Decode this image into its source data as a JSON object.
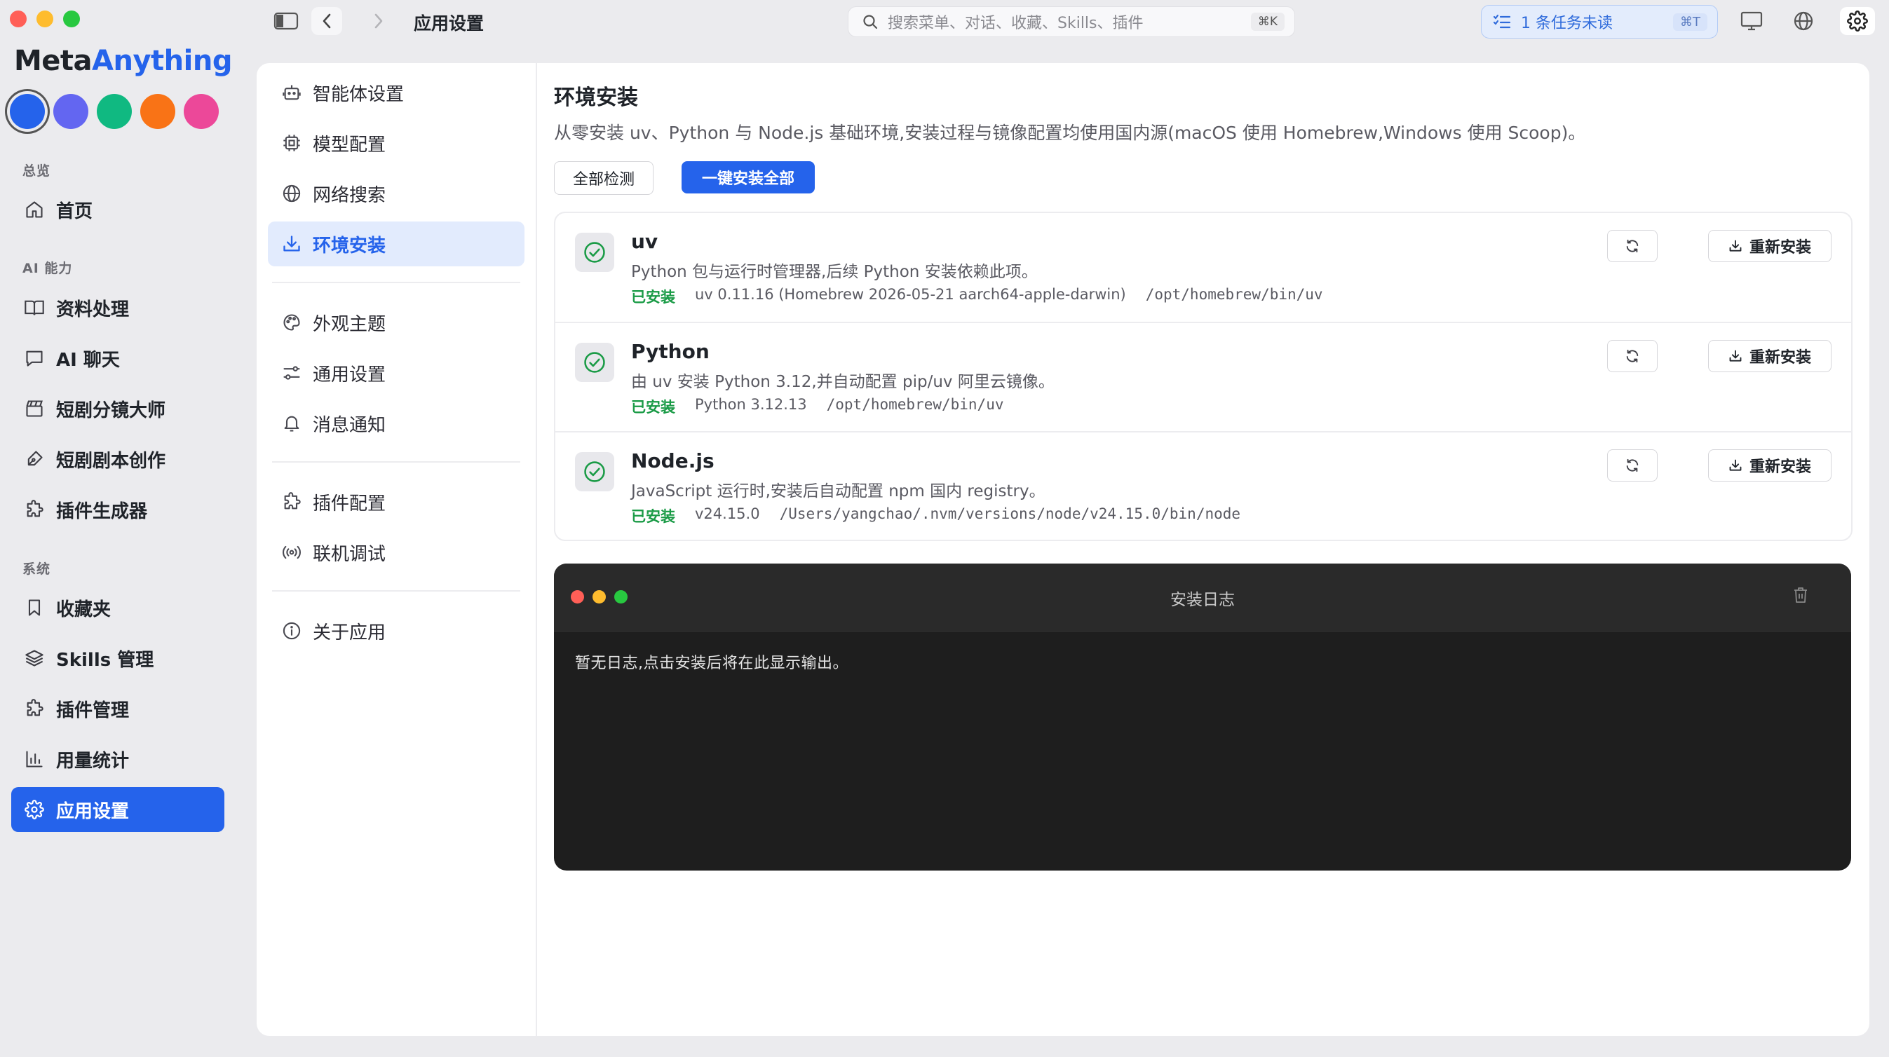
{
  "window": {
    "title": "应用设置"
  },
  "search": {
    "placeholder": "搜索菜单、对话、收藏、Skills、插件",
    "shortcut": "⌘K"
  },
  "tasks": {
    "label": "1 条任务未读",
    "shortcut": "⌘T"
  },
  "brand": {
    "part1": "Meta",
    "part2": "Anything"
  },
  "theme_colors": [
    "#2563eb",
    "#6366f1",
    "#10b981",
    "#f97316",
    "#ec4899"
  ],
  "sidebar": {
    "groups": [
      {
        "label": "总览",
        "items": [
          {
            "label": "首页",
            "icon": "home-icon"
          }
        ]
      },
      {
        "label": "AI 能力",
        "items": [
          {
            "label": "资料处理",
            "icon": "book-icon"
          },
          {
            "label": "AI 聊天",
            "icon": "chat-icon"
          },
          {
            "label": "短剧分镜大师",
            "icon": "clapper-icon"
          },
          {
            "label": "短剧剧本创作",
            "icon": "pen-icon"
          },
          {
            "label": "插件生成器",
            "icon": "puzzle-icon"
          }
        ]
      },
      {
        "label": "系统",
        "items": [
          {
            "label": "收藏夹",
            "icon": "bookmark-icon"
          },
          {
            "label": "Skills 管理",
            "icon": "layers-icon"
          },
          {
            "label": "插件管理",
            "icon": "puzzle-icon"
          },
          {
            "label": "用量统计",
            "icon": "bar-chart-icon"
          },
          {
            "label": "应用设置",
            "icon": "gear-icon",
            "active": true
          }
        ]
      }
    ]
  },
  "settings_nav": [
    {
      "label": "智能体设置",
      "icon": "bot-icon"
    },
    {
      "label": "模型配置",
      "icon": "chip-icon"
    },
    {
      "label": "网络搜索",
      "icon": "globe-icon"
    },
    {
      "label": "环境安装",
      "icon": "download-icon",
      "active": true
    },
    {
      "label": "外观主题",
      "icon": "palette-icon"
    },
    {
      "label": "通用设置",
      "icon": "sliders-icon"
    },
    {
      "label": "消息通知",
      "icon": "bell-icon"
    },
    {
      "label": "插件配置",
      "icon": "puzzle-icon"
    },
    {
      "label": "联机调试",
      "icon": "broadcast-icon"
    },
    {
      "label": "关于应用",
      "icon": "info-icon"
    }
  ],
  "page": {
    "title": "环境安装",
    "description": "从零安装 uv、Python 与 Node.js 基础环境,安装过程与镜像配置均使用国内源(macOS 使用 Homebrew,Windows 使用 Scoop)。",
    "check_all_label": "全部检测",
    "install_all_label": "一键安装全部"
  },
  "tools": [
    {
      "name": "uv",
      "description": "Python 包与运行时管理器,后续 Python 安装依赖此项。",
      "status": "已安装",
      "version": "uv 0.11.16 (Homebrew 2026-05-21 aarch64-apple-darwin)",
      "path": "/opt/homebrew/bin/uv",
      "reinstall_label": "重新安装"
    },
    {
      "name": "Python",
      "description": "由 uv 安装 Python 3.12,并自动配置 pip/uv 阿里云镜像。",
      "status": "已安装",
      "version": "Python 3.12.13",
      "path": "/opt/homebrew/bin/uv",
      "reinstall_label": "重新安装"
    },
    {
      "name": "Node.js",
      "description": "JavaScript 运行时,安装后自动配置 npm 国内 registry。",
      "status": "已安装",
      "version": "v24.15.0",
      "path": "/Users/yangchao/.nvm/versions/node/v24.15.0/bin/node",
      "reinstall_label": "重新安装"
    }
  ],
  "log": {
    "title": "安装日志",
    "empty_text": "暂无日志,点击安装后将在此显示输出。"
  }
}
